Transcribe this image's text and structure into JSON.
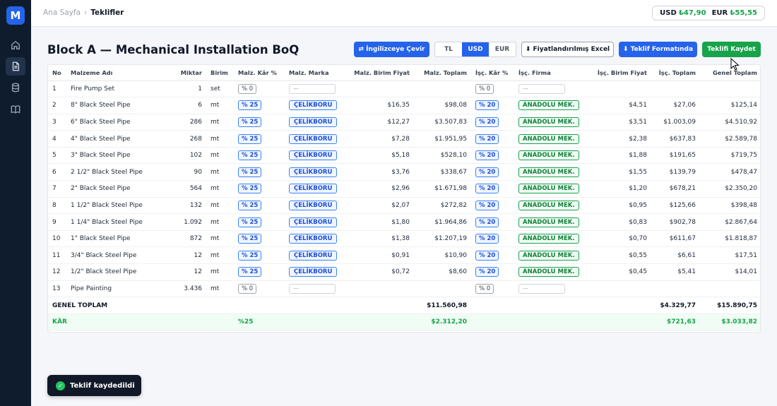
{
  "app": {
    "logo_letter": "M"
  },
  "sidebar": {
    "items": [
      {
        "icon": "home-icon",
        "active": false
      },
      {
        "icon": "document-icon",
        "active": true
      },
      {
        "icon": "database-icon",
        "active": false
      },
      {
        "icon": "book-icon",
        "active": false
      }
    ]
  },
  "breadcrumb": {
    "parent": "Ana Sayfa",
    "separator": "›",
    "current": "Teklifler"
  },
  "rates": {
    "usd_label": "USD",
    "usd_value": "₺47,90",
    "eur_label": "EUR",
    "eur_value": "₺55,55"
  },
  "page": {
    "title": "Block A — Mechanical Installation BoQ"
  },
  "toolbar": {
    "translate_label": "⇄ İngilizceye Çevir",
    "currency_options": [
      "TL",
      "USD",
      "EUR"
    ],
    "currency_selected": "USD",
    "excel_label": "⬇ Fiyatlandırılmış Excel",
    "format_label": "⬇ Teklif Formatında",
    "save_label": "Teklifi Kaydet"
  },
  "table": {
    "headers": [
      "No",
      "Malzeme Adı",
      "Miktar",
      "Birim",
      "Malz. Kâr %",
      "Malz. Marka",
      "Malz. Birim Fiyat",
      "Malz. Toplam",
      "İşç. Kâr %",
      "İşç. Firma",
      "İşç. Birim Fiyat",
      "İşç. Toplam",
      "Genel Toplam"
    ],
    "empty_placeholder": "—",
    "rows": [
      {
        "no": "1",
        "name": "Fire Pump Set",
        "qty": "1",
        "unit": "set",
        "mat_margin": "% 0",
        "brand": "",
        "mat_unit": "",
        "mat_total": "",
        "lab_margin": "% 0",
        "firm": "",
        "lab_unit": "",
        "lab_total": "",
        "grand": ""
      },
      {
        "no": "2",
        "name": "8\" Black Steel Pipe",
        "qty": "6",
        "unit": "mt",
        "mat_margin": "% 25",
        "brand": "ÇELİKBORU",
        "mat_unit": "$16,35",
        "mat_total": "$98,08",
        "lab_margin": "% 20",
        "firm": "ANADOLU MEK.",
        "lab_unit": "$4,51",
        "lab_total": "$27,06",
        "grand": "$125,14"
      },
      {
        "no": "3",
        "name": "6\" Black Steel Pipe",
        "qty": "286",
        "unit": "mt",
        "mat_margin": "% 25",
        "brand": "ÇELİKBORU",
        "mat_unit": "$12,27",
        "mat_total": "$3.507,83",
        "lab_margin": "% 20",
        "firm": "ANADOLU MEK.",
        "lab_unit": "$3,51",
        "lab_total": "$1.003,09",
        "grand": "$4.510,92"
      },
      {
        "no": "4",
        "name": "4\" Black Steel Pipe",
        "qty": "268",
        "unit": "mt",
        "mat_margin": "% 25",
        "brand": "ÇELİKBORU",
        "mat_unit": "$7,28",
        "mat_total": "$1.951,95",
        "lab_margin": "% 20",
        "firm": "ANADOLU MEK.",
        "lab_unit": "$2,38",
        "lab_total": "$637,83",
        "grand": "$2.589,78"
      },
      {
        "no": "5",
        "name": "3\" Black Steel Pipe",
        "qty": "102",
        "unit": "mt",
        "mat_margin": "% 25",
        "brand": "ÇELİKBORU",
        "mat_unit": "$5,18",
        "mat_total": "$528,10",
        "lab_margin": "% 20",
        "firm": "ANADOLU MEK.",
        "lab_unit": "$1,88",
        "lab_total": "$191,65",
        "grand": "$719,75"
      },
      {
        "no": "6",
        "name": "2 1/2\" Black Steel Pipe",
        "qty": "90",
        "unit": "mt",
        "mat_margin": "% 25",
        "brand": "ÇELİKBORU",
        "mat_unit": "$3,76",
        "mat_total": "$338,67",
        "lab_margin": "% 20",
        "firm": "ANADOLU MEK.",
        "lab_unit": "$1,55",
        "lab_total": "$139,79",
        "grand": "$478,47"
      },
      {
        "no": "7",
        "name": "2\" Black Steel Pipe",
        "qty": "564",
        "unit": "mt",
        "mat_margin": "% 25",
        "brand": "ÇELİKBORU",
        "mat_unit": "$2,96",
        "mat_total": "$1.671,98",
        "lab_margin": "% 20",
        "firm": "ANADOLU MEK.",
        "lab_unit": "$1,20",
        "lab_total": "$678,21",
        "grand": "$2.350,20"
      },
      {
        "no": "8",
        "name": "1 1/2\" Black Steel Pipe",
        "qty": "132",
        "unit": "mt",
        "mat_margin": "% 25",
        "brand": "ÇELİKBORU",
        "mat_unit": "$2,07",
        "mat_total": "$272,82",
        "lab_margin": "% 20",
        "firm": "ANADOLU MEK.",
        "lab_unit": "$0,95",
        "lab_total": "$125,66",
        "grand": "$398,48"
      },
      {
        "no": "9",
        "name": "1 1/4\" Black Steel Pipe",
        "qty": "1.092",
        "unit": "mt",
        "mat_margin": "% 25",
        "brand": "ÇELİKBORU",
        "mat_unit": "$1,80",
        "mat_total": "$1.964,86",
        "lab_margin": "% 20",
        "firm": "ANADOLU MEK.",
        "lab_unit": "$0,83",
        "lab_total": "$902,78",
        "grand": "$2.867,64"
      },
      {
        "no": "10",
        "name": "1\" Black Steel Pipe",
        "qty": "872",
        "unit": "mt",
        "mat_margin": "% 25",
        "brand": "ÇELİKBORU",
        "mat_unit": "$1,38",
        "mat_total": "$1.207,19",
        "lab_margin": "% 20",
        "firm": "ANADOLU MEK.",
        "lab_unit": "$0,70",
        "lab_total": "$611,67",
        "grand": "$1.818,87"
      },
      {
        "no": "11",
        "name": "3/4\" Black Steel Pipe",
        "qty": "12",
        "unit": "mt",
        "mat_margin": "% 25",
        "brand": "ÇELİKBORU",
        "mat_unit": "$0,91",
        "mat_total": "$10,90",
        "lab_margin": "% 20",
        "firm": "ANADOLU MEK.",
        "lab_unit": "$0,55",
        "lab_total": "$6,61",
        "grand": "$17,51"
      },
      {
        "no": "12",
        "name": "1/2\" Black Steel Pipe",
        "qty": "12",
        "unit": "mt",
        "mat_margin": "% 25",
        "brand": "ÇELİKBORU",
        "mat_unit": "$0,72",
        "mat_total": "$8,60",
        "lab_margin": "% 20",
        "firm": "ANADOLU MEK.",
        "lab_unit": "$0,45",
        "lab_total": "$5,41",
        "grand": "$14,01"
      },
      {
        "no": "13",
        "name": "Pipe Painting",
        "qty": "3.436",
        "unit": "mt",
        "mat_margin": "% 0",
        "brand": "",
        "mat_unit": "",
        "mat_total": "",
        "lab_margin": "% 0",
        "firm": "",
        "lab_unit": "",
        "lab_total": "",
        "grand": ""
      }
    ],
    "total": {
      "label": "GENEL TOPLAM",
      "mat_total": "$11.560,98",
      "lab_total": "$4.329,77",
      "grand": "$15.890,75"
    },
    "profit": {
      "label": "KÂR",
      "margin": "%25",
      "mat_total": "$2.312,20",
      "lab_total": "$721,63",
      "grand": "$3.033,82"
    }
  },
  "toast": {
    "message": "Teklif kaydedildi",
    "icon": "check-icon"
  }
}
